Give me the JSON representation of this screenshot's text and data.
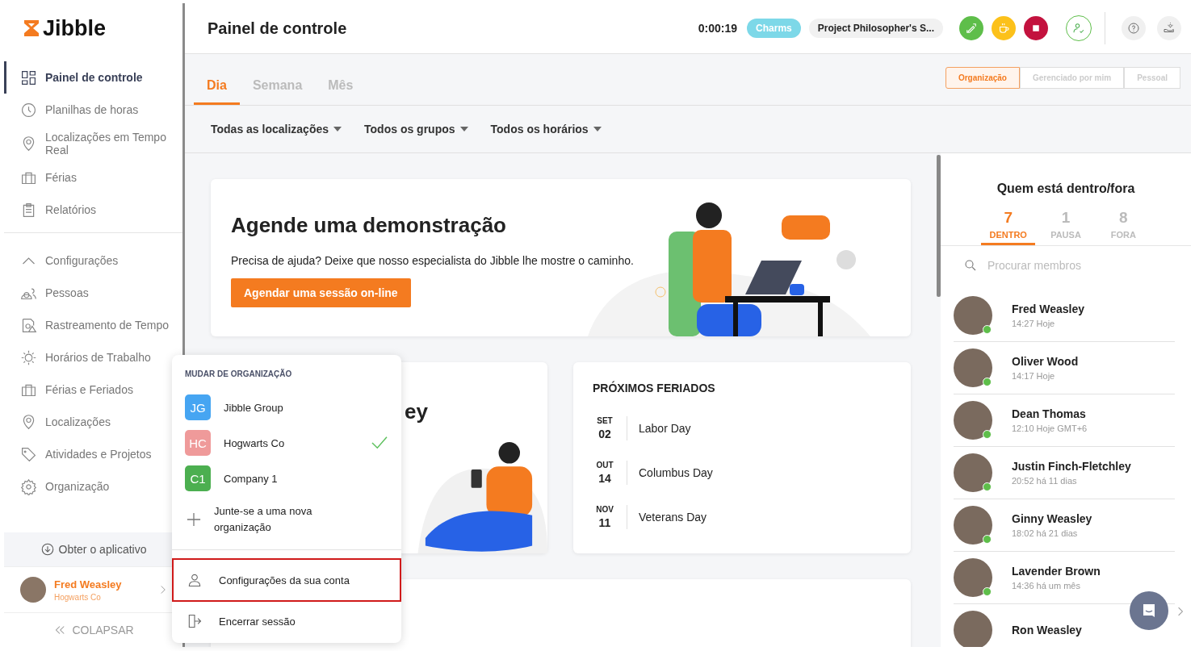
{
  "logo": {
    "text": "Jibble"
  },
  "sidebar": {
    "items": [
      {
        "label": "Painel de controle",
        "selected": true
      },
      {
        "label": "Planilhas de horas",
        "selected": false
      },
      {
        "label": "Localizações em Tempo Real",
        "selected": false
      },
      {
        "label": "Férias",
        "selected": false
      },
      {
        "label": "Relatórios",
        "selected": false
      }
    ],
    "settings": {
      "label": "Configurações",
      "expanded": true,
      "items": [
        {
          "label": "Pessoas",
          "selected": false
        },
        {
          "label": "Rastreamento de Tempo",
          "selected": false
        },
        {
          "label": "Horários de Trabalho",
          "selected": false
        },
        {
          "label": "Férias e Feriados",
          "selected": false
        },
        {
          "label": "Localizações",
          "selected": false
        },
        {
          "label": "Atividades e Projetos",
          "selected": false
        },
        {
          "label": "Organização",
          "selected": false
        }
      ]
    },
    "get_app": "Obter o aplicativo",
    "user": {
      "name": "Fred Weasley",
      "org": "Hogwarts Co"
    },
    "collapse": "COLAPSAR"
  },
  "header": {
    "title": "Painel de controle",
    "timer": "0:00:19",
    "activity": "Charms",
    "project": "Project Philosopher's S..."
  },
  "tabs": [
    {
      "label": "Dia",
      "selected": true
    },
    {
      "label": "Semana",
      "selected": false
    },
    {
      "label": "Mês",
      "selected": false
    }
  ],
  "scope": [
    {
      "label": "Organização",
      "selected": true
    },
    {
      "label": "Gerenciado por mim",
      "selected": false
    },
    {
      "label": "Pessoal",
      "selected": false
    }
  ],
  "filters": [
    "Todas as localizações",
    "Todos os grupos",
    "Todos os horários"
  ],
  "demo_card": {
    "title": "Agende uma demonstração",
    "text": "Precisa de ajuda? Deixe que nosso especialista do Jibble lhe mostre o caminho.",
    "button": "Agendar uma sessão on-line"
  },
  "second_card": {
    "title_fragment": "ey"
  },
  "holidays": {
    "title": "PRÓXIMOS FERIADOS",
    "items": [
      {
        "month": "SET",
        "day": "02",
        "name": "Labor Day"
      },
      {
        "month": "OUT",
        "day": "14",
        "name": "Columbus Day"
      },
      {
        "month": "NOV",
        "day": "11",
        "name": "Veterans Day"
      }
    ]
  },
  "who": {
    "title": "Quem está dentro/fora",
    "tabs": [
      {
        "count": "7",
        "label": "DENTRO",
        "selected": true
      },
      {
        "count": "1",
        "label": "PAUSA",
        "selected": false
      },
      {
        "count": "8",
        "label": "FORA",
        "selected": false
      }
    ],
    "search_placeholder": "Procurar membros",
    "members": [
      {
        "name": "Fred Weasley",
        "time": "14:27 Hoje",
        "online": true
      },
      {
        "name": "Oliver Wood",
        "time": "14:17 Hoje",
        "online": true
      },
      {
        "name": "Dean Thomas",
        "time": "12:10 Hoje GMT+6",
        "online": true
      },
      {
        "name": "Justin Finch-Fletchley",
        "time": "20:52 há 11 dias",
        "online": true
      },
      {
        "name": "Ginny Weasley",
        "time": "18:02 há 21 dias",
        "online": true
      },
      {
        "name": "Lavender Brown",
        "time": "14:36 há um mês",
        "online": true
      },
      {
        "name": "Ron Weasley",
        "online": false
      }
    ]
  },
  "org_menu": {
    "heading": "MUDAR DE ORGANIZAÇÃO",
    "orgs": [
      {
        "initials": "JG",
        "name": "Jibble Group",
        "color": "#46a5f2",
        "selected": false
      },
      {
        "initials": "HC",
        "name": "Hogwarts Co",
        "color": "#ef9a9a",
        "selected": true
      },
      {
        "initials": "C1",
        "name": "Company 1",
        "color": "#4caf50",
        "selected": false
      }
    ],
    "join": "Junte-se a uma nova organização",
    "account": {
      "label": "Configurações da sua conta",
      "highlighted": true
    },
    "logout": "Encerrar sessão"
  }
}
